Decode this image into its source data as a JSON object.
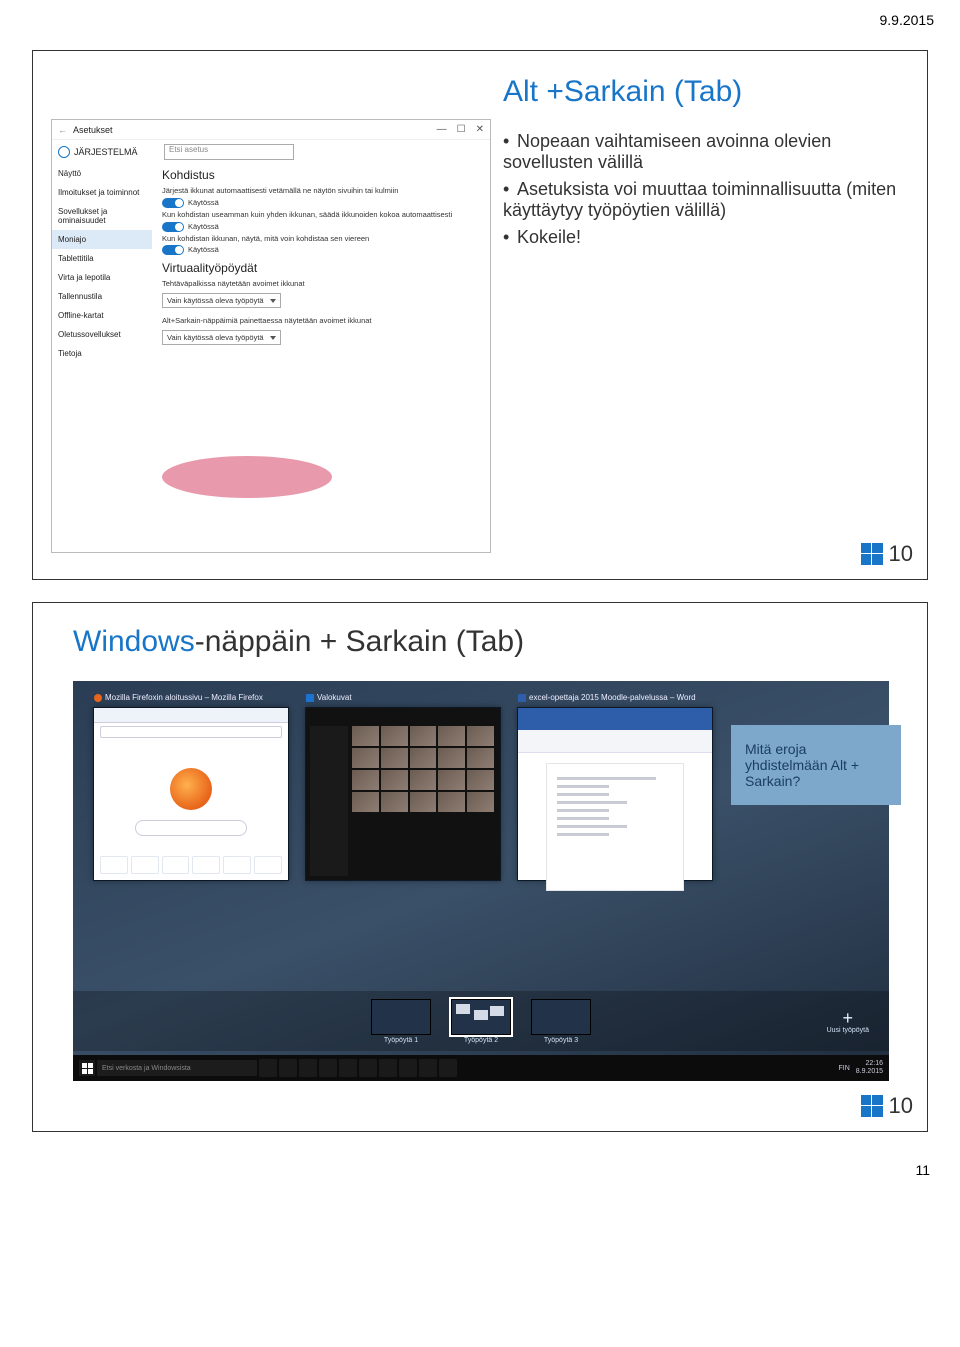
{
  "header_date": "9.9.2015",
  "page_number": "11",
  "slide1": {
    "title": "Alt +Sarkain (Tab)",
    "bullets": [
      "Nopeaan vaihtamiseen avoinna olevien sovellusten välillä",
      "Asetuksista voi muuttaa toiminnallisuutta (miten käyttäytyy työpöytien välillä)",
      "Kokeile!"
    ],
    "badge": "10",
    "settings": {
      "back_arrow": "←",
      "window_title": "Asetukset",
      "win_min": "—",
      "win_max": "☐",
      "win_close": "✕",
      "section_head": "JÄRJESTELMÄ",
      "side_items": [
        "Näyttö",
        "Ilmoitukset ja toiminnot",
        "Sovellukset ja ominaisuudet",
        "Moniajo",
        "Tablettitila",
        "Virta ja lepotila",
        "Tallennustila",
        "Offline-kartat",
        "Oletussovellukset",
        "Tietoja"
      ],
      "side_selected_index": 3,
      "search_placeholder": "Etsi asetus",
      "h_kohdistus": "Kohdistus",
      "p_snap1": "Järjestä ikkunat automaattisesti vetämällä ne näytön sivuihin tai kulmiin",
      "toggle_label": "Käytössä",
      "p_snap2": "Kun kohdistan useamman kuin yhden ikkunan, säädä ikkunoiden kokoa automaattisesti",
      "p_snap3": "Kun kohdistan ikkunan, näytä, mitä voin kohdistaa sen viereen",
      "h_virtual": "Virtuaalityöpöydät",
      "p_virtual1": "Tehtäväpalkissa näytetään avoimet ikkunat",
      "dd_value": "Vain käytössä oleva työpöytä",
      "p_virtual2": "Alt+Sarkain-näppäimiä painettaessa näytetään avoimet ikkunat"
    }
  },
  "slide2": {
    "title_blue": "Windows",
    "title_rest": "-näppäin + Sarkain (Tab)",
    "callout": "Mitä eroja yhdistelmään Alt + Sarkain?",
    "win_labels": [
      "Mozilla Firefoxin aloitussivu – Mozilla Firefox",
      "Valokuvat",
      "excel-opettaja 2015 Moodle-palvelussa – Word"
    ],
    "desktops": [
      "Työpöytä 1",
      "Työpöytä 2",
      "Työpöytä 3"
    ],
    "new_desktop": "Uusi työpöytä",
    "taskbar_search": "Etsi verkosta ja Windowsista",
    "taskbar_time": "22:16",
    "taskbar_date": "8.9.2015",
    "taskbar_lang": "FIN",
    "badge": "10"
  }
}
